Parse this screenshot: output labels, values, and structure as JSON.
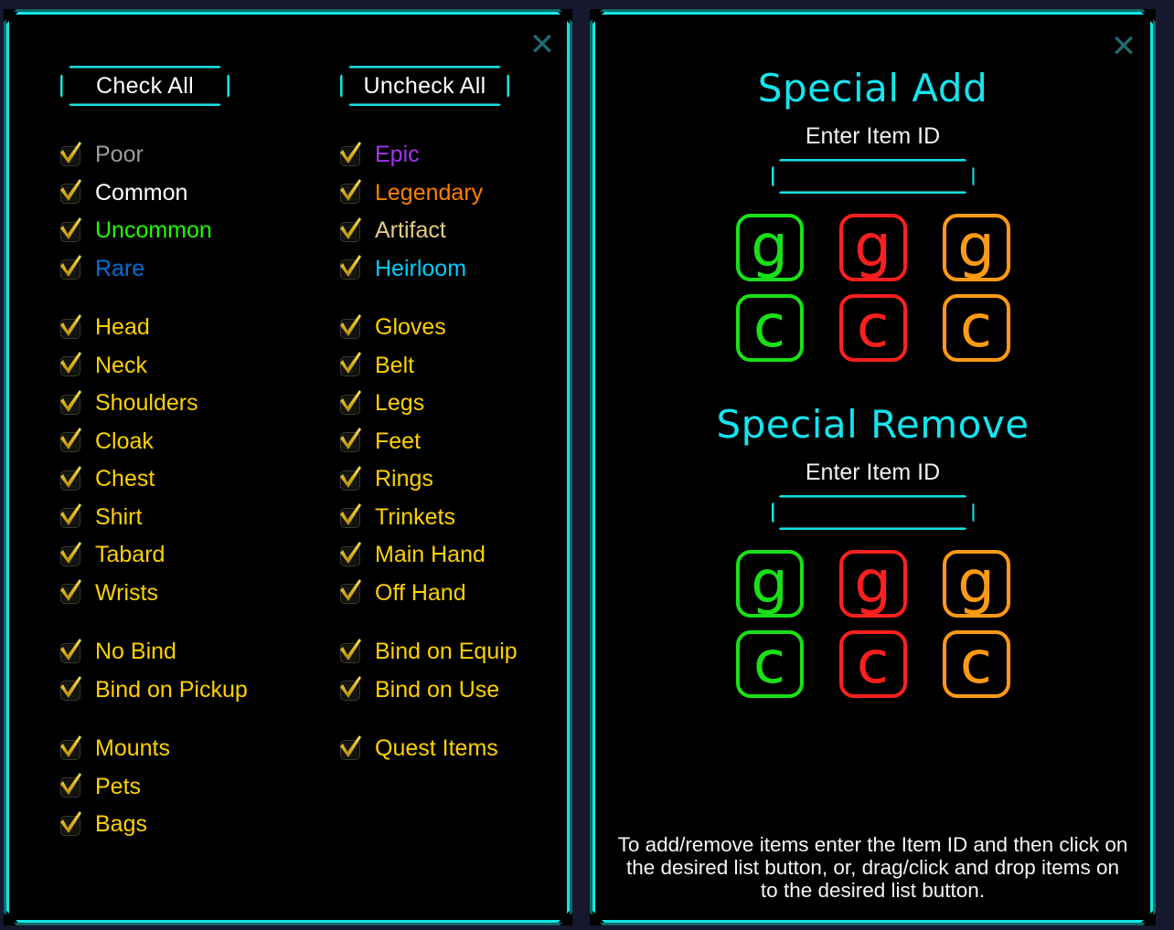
{
  "theme": {
    "accent_cyan": "#13e6e6",
    "accent_dim": "#0c6a68",
    "background": "#16182e",
    "panel_bg": "#000000",
    "close_icon_color": "#1f6b70"
  },
  "left_panel": {
    "close_label": "✕",
    "buttons": {
      "check_all": "Check All",
      "uncheck_all": "Uncheck All"
    },
    "groups": [
      {
        "name": "quality",
        "column_a": [
          {
            "label": "Poor",
            "color": "#9d9d9d",
            "checked": true
          },
          {
            "label": "Common",
            "color": "#ffffff",
            "checked": true
          },
          {
            "label": "Uncommon",
            "color": "#1eff00",
            "checked": true
          },
          {
            "label": "Rare",
            "color": "#0070dd",
            "checked": true
          }
        ],
        "column_b": [
          {
            "label": "Epic",
            "color": "#a335ee",
            "checked": true
          },
          {
            "label": "Legendary",
            "color": "#ff8000",
            "checked": true
          },
          {
            "label": "Artifact",
            "color": "#e6cc80",
            "checked": true
          },
          {
            "label": "Heirloom",
            "color": "#00ccff",
            "checked": true
          }
        ]
      },
      {
        "name": "equipment-slots",
        "column_a": [
          {
            "label": "Head",
            "color": "#ffd100",
            "checked": true
          },
          {
            "label": "Neck",
            "color": "#ffd100",
            "checked": true
          },
          {
            "label": "Shoulders",
            "color": "#ffd100",
            "checked": true
          },
          {
            "label": "Cloak",
            "color": "#ffd100",
            "checked": true
          },
          {
            "label": "Chest",
            "color": "#ffd100",
            "checked": true
          },
          {
            "label": "Shirt",
            "color": "#ffd100",
            "checked": true
          },
          {
            "label": "Tabard",
            "color": "#ffd100",
            "checked": true
          },
          {
            "label": "Wrists",
            "color": "#ffd100",
            "checked": true
          }
        ],
        "column_b": [
          {
            "label": "Gloves",
            "color": "#ffd100",
            "checked": true
          },
          {
            "label": "Belt",
            "color": "#ffd100",
            "checked": true
          },
          {
            "label": "Legs",
            "color": "#ffd100",
            "checked": true
          },
          {
            "label": "Feet",
            "color": "#ffd100",
            "checked": true
          },
          {
            "label": "Rings",
            "color": "#ffd100",
            "checked": true
          },
          {
            "label": "Trinkets",
            "color": "#ffd100",
            "checked": true
          },
          {
            "label": "Main Hand",
            "color": "#ffd100",
            "checked": true
          },
          {
            "label": "Off Hand",
            "color": "#ffd100",
            "checked": true
          }
        ]
      },
      {
        "name": "binding",
        "column_a": [
          {
            "label": "No Bind",
            "color": "#ffd100",
            "checked": true
          },
          {
            "label": "Bind on Pickup",
            "color": "#ffd100",
            "checked": true
          }
        ],
        "column_b": [
          {
            "label": "Bind on Equip",
            "color": "#ffd100",
            "checked": true
          },
          {
            "label": "Bind on Use",
            "color": "#ffd100",
            "checked": true
          }
        ]
      },
      {
        "name": "misc",
        "column_a": [
          {
            "label": "Mounts",
            "color": "#ffd100",
            "checked": true
          },
          {
            "label": "Pets",
            "color": "#ffd100",
            "checked": true
          },
          {
            "label": "Bags",
            "color": "#ffd100",
            "checked": true
          }
        ],
        "column_b": [
          {
            "label": "Quest Items",
            "color": "#ffd100",
            "checked": true
          }
        ]
      }
    ]
  },
  "right_panel": {
    "close_label": "✕",
    "sections": [
      {
        "title": "Special Add",
        "field_label": "Enter Item ID",
        "field_value": "",
        "field_placeholder": "",
        "list_buttons": [
          {
            "glyph": "g",
            "color": "#19e019",
            "name": "green-good-list"
          },
          {
            "glyph": "g",
            "color": "#ff1f1f",
            "name": "red-bad-list"
          },
          {
            "glyph": "g",
            "color": "#ff9a14",
            "name": "orange-list"
          },
          {
            "glyph": "c",
            "color": "#19e019",
            "name": "green-c-list"
          },
          {
            "glyph": "c",
            "color": "#ff1f1f",
            "name": "red-c-list"
          },
          {
            "glyph": "c",
            "color": "#ff9a14",
            "name": "orange-c-list"
          }
        ]
      },
      {
        "title": "Special Remove",
        "field_label": "Enter Item ID",
        "field_value": "",
        "field_placeholder": "",
        "list_buttons": [
          {
            "glyph": "g",
            "color": "#19e019",
            "name": "green-good-list"
          },
          {
            "glyph": "g",
            "color": "#ff1f1f",
            "name": "red-bad-list"
          },
          {
            "glyph": "g",
            "color": "#ff9a14",
            "name": "orange-list"
          },
          {
            "glyph": "c",
            "color": "#19e019",
            "name": "green-c-list"
          },
          {
            "glyph": "c",
            "color": "#ff1f1f",
            "name": "red-c-list"
          },
          {
            "glyph": "c",
            "color": "#ff9a14",
            "name": "orange-c-list"
          }
        ]
      }
    ],
    "help_text": "To add/remove items enter the Item ID and then click on the desired list button, or, drag/click and drop items on to the desired list button."
  }
}
